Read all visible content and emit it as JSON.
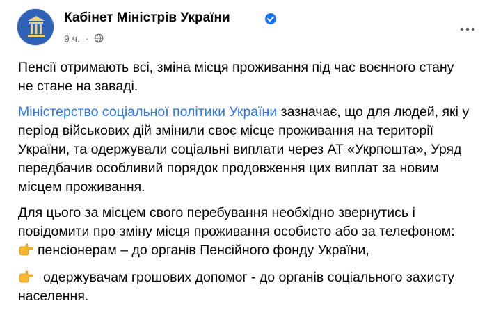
{
  "post": {
    "author": "Кабінет Міністрів України",
    "time": "9 ч.",
    "dot": "·",
    "more_label": "···",
    "headline": "Пенсії отримають всі, зміна місця проживання під час воєнного стану не стане на заваді.",
    "p2_link": "Міністерство соціальної політики України",
    "p2_rest": " зазначає, що для людей, які у період військових дій змінили своє місце проживання на території України, та одержували соціальні виплати через АТ «Укрпошта», Уряд передбачив особливий порядок продовження цих виплат за новим місцем проживання.",
    "p3": "Для цього за місцем свого перебування необхідно звернутись і повідомити про зміну місця проживання особисто або за телефоном:",
    "bullets": [
      "пенсіонерам – до органів Пенсійного фонду України,",
      "одержувачам грошових допомог - до органів соціального захисту населення."
    ]
  },
  "icons": {
    "verified": "verified-badge-icon",
    "privacy": "globe-icon",
    "more": "more-options-icon",
    "bullet": "backhand-index-pointing-right-icon"
  },
  "colors": {
    "link": "#2a74f6",
    "meta": "#65676b",
    "verified": "#1877f2",
    "avatar": "#2f63b7"
  }
}
